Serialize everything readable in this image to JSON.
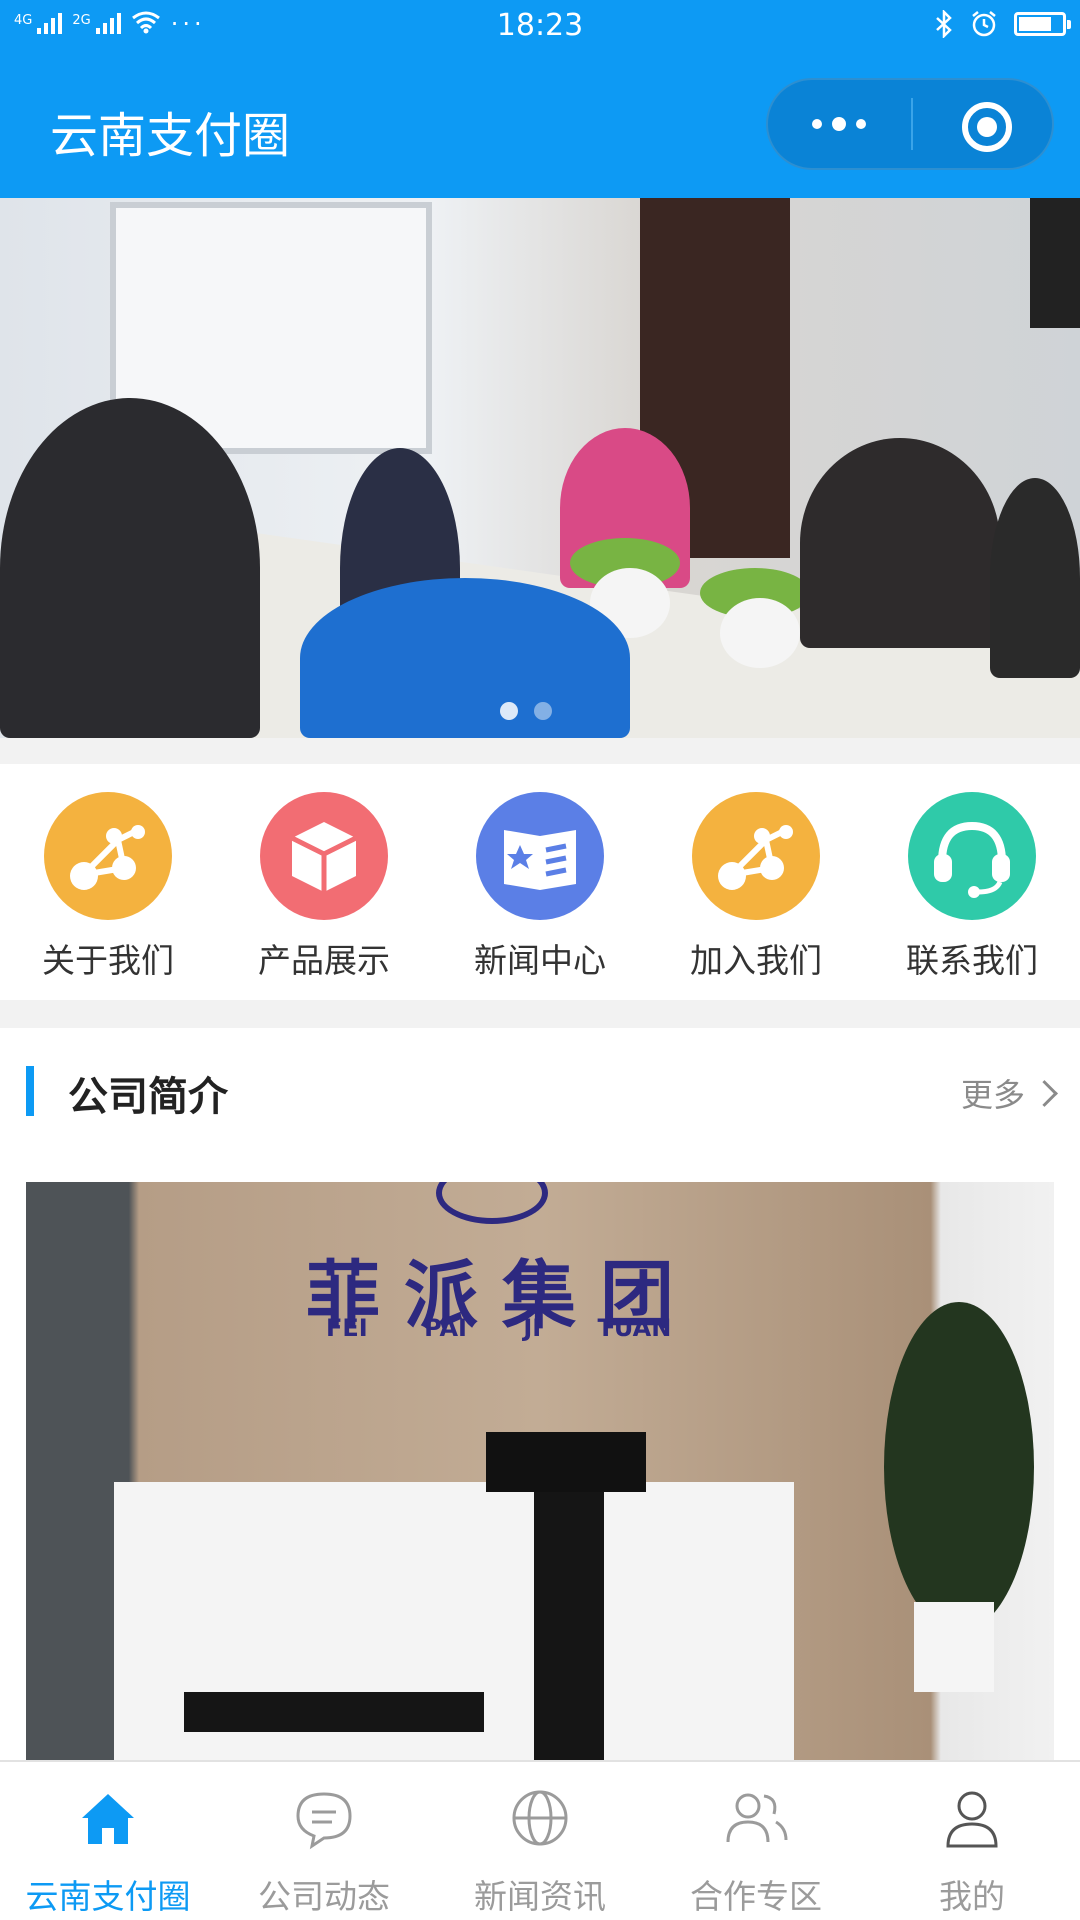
{
  "status_bar": {
    "time": "18:23",
    "network_1": "4G",
    "network_2": "2G",
    "more_indicator": "···",
    "icons": [
      "signal-icon",
      "wifi-icon",
      "bluetooth-icon",
      "alarm-icon",
      "battery-icon"
    ],
    "battery_level": 0.75
  },
  "header": {
    "title": "云南支付圈",
    "capsule": [
      "more-icon",
      "close-target-icon"
    ]
  },
  "banner": {
    "slide_count": 2,
    "active_slide": 1
  },
  "nav": {
    "items": [
      {
        "label": "关于我们",
        "icon": "share-nodes-icon",
        "color": "#f4b23f"
      },
      {
        "label": "产品展示",
        "icon": "cube-icon",
        "color": "#f26d73"
      },
      {
        "label": "新闻中心",
        "icon": "news-icon",
        "color": "#5b7fe6"
      },
      {
        "label": "加入我们",
        "icon": "share-nodes-icon",
        "color": "#f4b23f"
      },
      {
        "label": "联系我们",
        "icon": "headset-icon",
        "color": "#2fcaa9"
      }
    ]
  },
  "section": {
    "title": "公司简介",
    "more": "更多",
    "photo_sign": "菲派集团",
    "photo_sign_pinyin": "FEI PAI JI TUAN"
  },
  "tabbar": {
    "items": [
      {
        "label": "云南支付圈",
        "icon": "home-icon",
        "active": true
      },
      {
        "label": "公司动态",
        "icon": "chat-icon",
        "active": false
      },
      {
        "label": "新闻资讯",
        "icon": "globe-icon",
        "active": false
      },
      {
        "label": "合作专区",
        "icon": "users-icon",
        "active": false
      },
      {
        "label": "我的",
        "icon": "user-icon",
        "active": false
      }
    ]
  },
  "colors": {
    "brand": "#0d9af4",
    "active_tab": "#0d9af4",
    "inactive_tab": "#9b9b9b"
  }
}
